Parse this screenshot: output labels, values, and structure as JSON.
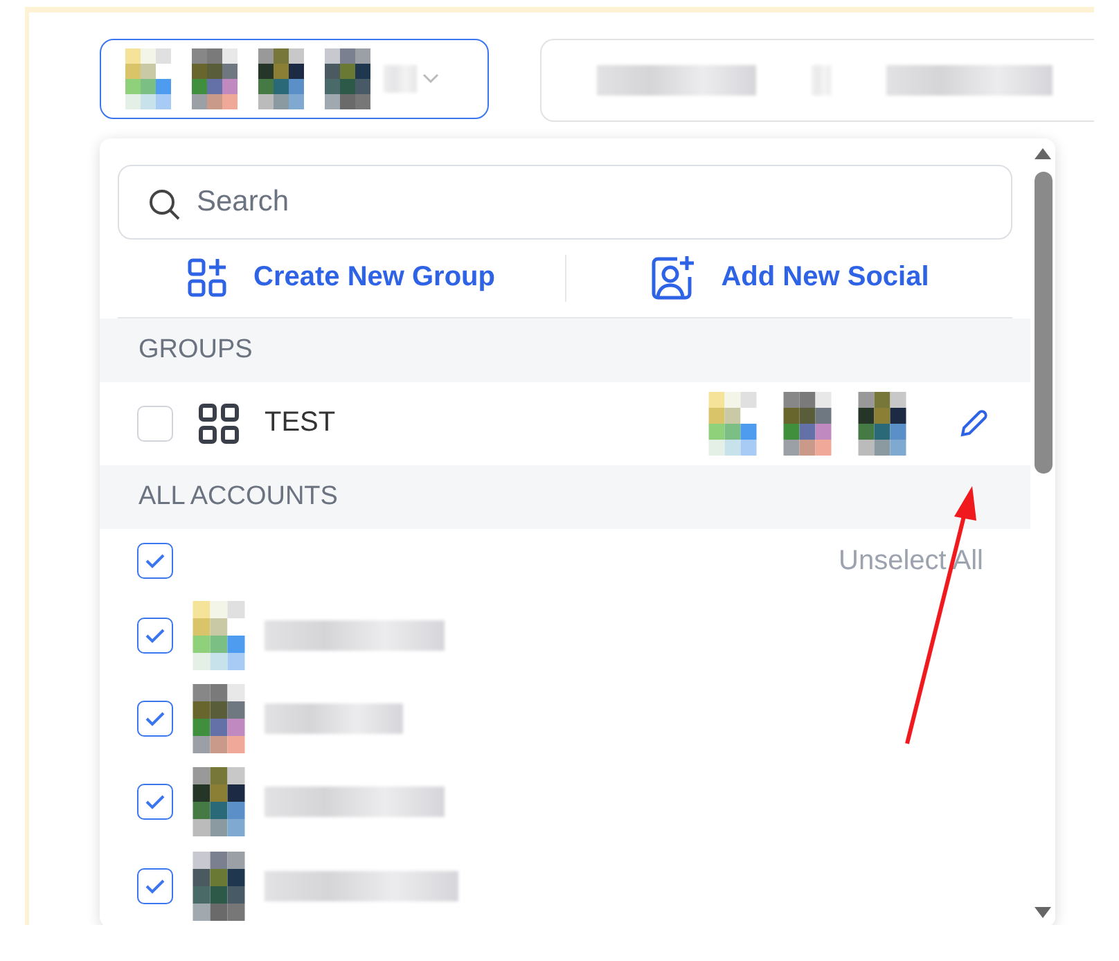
{
  "account_selector": {
    "expanded": true
  },
  "dropdown": {
    "search": {
      "placeholder": "Search"
    },
    "actions": [
      {
        "label": "Create New Group",
        "kind": "group"
      },
      {
        "label": "Add New Social",
        "kind": "social"
      }
    ],
    "groups_header": "GROUPS",
    "groups": [
      {
        "name": "TEST",
        "checked": false
      }
    ],
    "accounts_header": "ALL ACCOUNTS",
    "select_all": {
      "checked": true,
      "action": "Unselect All"
    },
    "accounts": [
      {
        "checked": true
      },
      {
        "checked": true
      },
      {
        "checked": true
      },
      {
        "checked": true
      }
    ]
  }
}
